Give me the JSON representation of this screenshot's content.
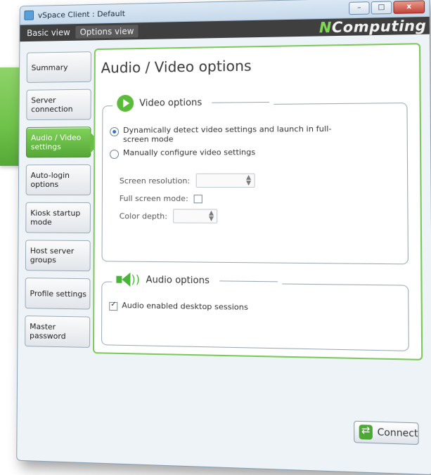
{
  "window": {
    "title": "vSpace Client : Default",
    "minimize": "–",
    "maximize": "□",
    "close": "x"
  },
  "menubar": {
    "tabs": [
      {
        "label": "Basic view",
        "active": false
      },
      {
        "label": "Options view",
        "active": true
      }
    ],
    "brand_n": "N",
    "brand_rest": "Computing"
  },
  "sidebar": {
    "items": [
      {
        "label": "Summary"
      },
      {
        "label": "Server connection"
      },
      {
        "label": "Audio / Video settings"
      },
      {
        "label": "Auto-login options"
      },
      {
        "label": "Kiosk startup mode"
      },
      {
        "label": "Host server groups"
      },
      {
        "label": "Profile settings"
      },
      {
        "label": "Master password"
      }
    ]
  },
  "main": {
    "title": "Audio / Video options",
    "video": {
      "title": "Video options",
      "opt_auto": "Dynamically detect video settings and launch in full-screen mode",
      "opt_manual": "Manually configure video settings",
      "screen_resolution": "Screen resolution:",
      "full_screen_mode": "Full screen mode:",
      "color_depth": "Color depth:"
    },
    "audio": {
      "title": "Audio options",
      "enabled_label": "Audio enabled desktop sessions"
    }
  },
  "footer": {
    "connect": "Connect"
  },
  "colors": {
    "accent": "#6fc24a",
    "menubar": "#3f3f3f"
  }
}
